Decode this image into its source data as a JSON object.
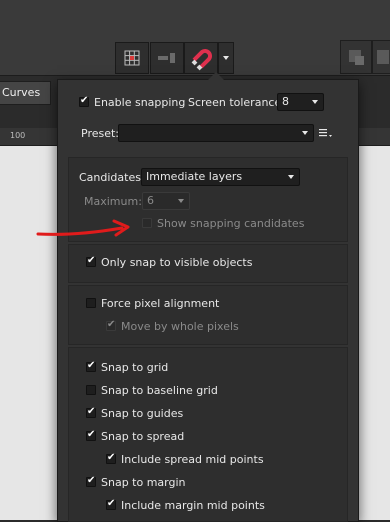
{
  "app": {
    "curves_tab": "Curves",
    "ruler_label": "100"
  },
  "snapping": {
    "enable_snapping": {
      "label": "Enable snapping",
      "checked": true
    },
    "screen_tolerance": {
      "label": "Screen tolerance:",
      "value": "8"
    },
    "preset": {
      "label": "Preset:",
      "value": ""
    },
    "candidates": {
      "label": "Candidates:",
      "value": "Immediate layers"
    },
    "maximum": {
      "label": "Maximum:",
      "value": "6"
    },
    "show_candidates": {
      "label": "Show snapping candidates",
      "checked": false
    },
    "only_visible": {
      "label": "Only snap to visible objects",
      "checked": true
    },
    "force_pixel": {
      "label": "Force pixel alignment",
      "checked": false
    },
    "move_whole_pixels": {
      "label": "Move by whole pixels",
      "checked": true
    },
    "snap_grid": {
      "label": "Snap to grid",
      "checked": true
    },
    "snap_baseline": {
      "label": "Snap to baseline grid",
      "checked": false
    },
    "snap_guides": {
      "label": "Snap to guides",
      "checked": true
    },
    "snap_spread": {
      "label": "Snap to spread",
      "checked": true
    },
    "spread_mid": {
      "label": "Include spread mid points",
      "checked": true
    },
    "snap_margin": {
      "label": "Snap to margin",
      "checked": true
    },
    "margin_mid": {
      "label": "Include margin mid points",
      "checked": true
    }
  },
  "icons": {
    "grid": "grid-icon",
    "guides": "guides-icon",
    "magnet": "magnet-icon",
    "preset_menu": "hamburger-menu-icon"
  },
  "colors": {
    "magnet": "#e0304e",
    "arrow": "#e01b1b",
    "panel": "#333333"
  }
}
